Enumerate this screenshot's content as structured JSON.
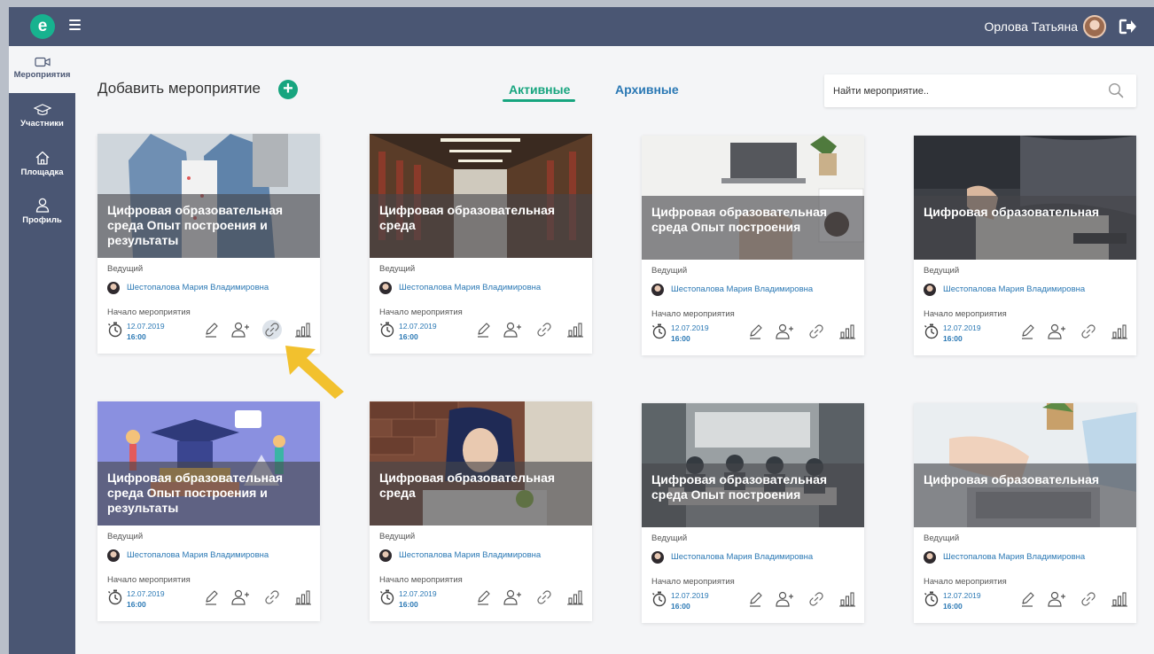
{
  "header": {
    "logo_letter": "e",
    "user_name": "Орлова Татьяна"
  },
  "sidebar": {
    "items": [
      {
        "label": "Мероприятия",
        "icon": "video-camera-icon",
        "active": true
      },
      {
        "label": "Участники",
        "icon": "graduation-cap-icon",
        "active": false
      },
      {
        "label": "Площадка",
        "icon": "home-icon",
        "active": false
      },
      {
        "label": "Профиль",
        "icon": "person-icon",
        "active": false
      }
    ]
  },
  "toolbar": {
    "add_label": "Добавить мероприятие",
    "add_symbol": "+",
    "tab_active": "Активные",
    "tab_archive": "Архивные",
    "search_placeholder": "Найти мероприятие.."
  },
  "cards": [
    {
      "title": "Цифровая образовательная среда Опыт построения и результаты",
      "host_label": "Ведущий",
      "host_name": "Шестопалова Мария Владимировна",
      "start_label": "Начало мероприятия",
      "date": "12.07.2019",
      "time": "16:00",
      "image": "student-backpack"
    },
    {
      "title": "Цифровая образовательная среда",
      "host_label": "Ведущий",
      "host_name": "Шестопалова Мария Владимировна",
      "start_label": "Начало мероприятия",
      "date": "12.07.2019",
      "time": "16:00",
      "image": "library"
    },
    {
      "title": "Цифровая образовательная среда Опыт построения",
      "host_label": "Ведущий",
      "host_name": "Шестопалова Мария Владимировна",
      "start_label": "Начало мероприятия",
      "date": "12.07.2019",
      "time": "16:00",
      "image": "laptop-desk"
    },
    {
      "title": "Цифровая образовательная",
      "host_label": "Ведущий",
      "host_name": "Шестопалова Мария Владимировна",
      "start_label": "Начало мероприятия",
      "date": "12.07.2019",
      "time": "16:00",
      "image": "reading-book"
    },
    {
      "title": "Цифровая образовательная среда Опыт построения и результаты",
      "host_label": "Ведущий",
      "host_name": "Шестопалова Мария Владимировна",
      "start_label": "Начало мероприятия",
      "date": "12.07.2019",
      "time": "16:00",
      "image": "education-illustration"
    },
    {
      "title": "Цифровая образовательная среда",
      "host_label": "Ведущий",
      "host_name": "Шестопалова Мария Владимировна",
      "start_label": "Начало мероприятия",
      "date": "12.07.2019",
      "time": "16:00",
      "image": "girl-studying"
    },
    {
      "title": "Цифровая образовательная среда Опыт построения",
      "host_label": "Ведущий",
      "host_name": "Шестопалова Мария Владимировна",
      "start_label": "Начало мероприятия",
      "date": "12.07.2019",
      "time": "16:00",
      "image": "office-meeting"
    },
    {
      "title": "Цифровая образовательная",
      "host_label": "Ведущий",
      "host_name": "Шестопалова Мария Владимировна",
      "start_label": "Начало мероприятия",
      "date": "12.07.2019",
      "time": "16:00",
      "image": "laptop-writing"
    }
  ],
  "colors": {
    "nav_bg": "#4a5673",
    "accent_green": "#17a57f",
    "link_blue": "#2a78b4",
    "pointer_arrow": "#f2c12e"
  }
}
